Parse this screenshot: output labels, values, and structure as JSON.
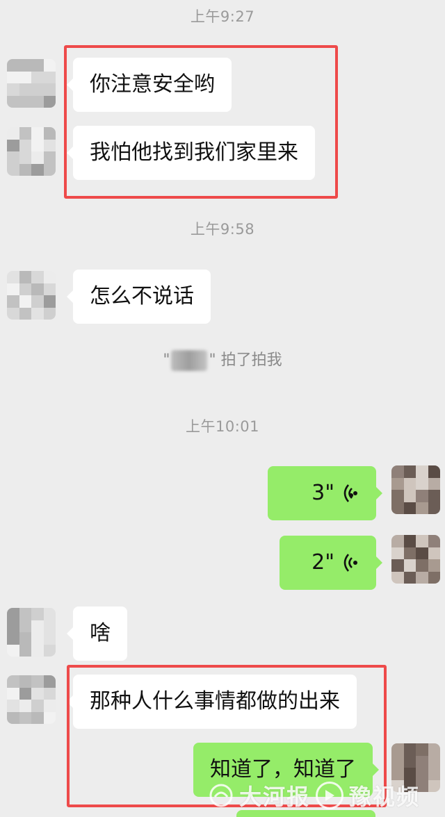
{
  "timestamps": [
    "上午9:27",
    "上午9:58",
    "上午10:01"
  ],
  "messages": [
    {
      "text": "你注意安全哟"
    },
    {
      "text": "我怕他找到我们家里来"
    },
    {
      "text": "怎么不说话"
    },
    {
      "text": "3\""
    },
    {
      "text": "2\""
    },
    {
      "text": "啥"
    },
    {
      "text": "那种人什么事情都做的出来"
    },
    {
      "text": "知道了，知道了"
    }
  ],
  "system_message": {
    "open_quote": "\"",
    "close_quote": "\"",
    "action": "拍了拍我"
  },
  "watermark": {
    "brand1": "大河报",
    "brand2": "豫视频"
  },
  "colors": {
    "incoming_bubble": "#ffffff",
    "outgoing_bubble": "#95ec69",
    "highlight_box": "#ee4a4a",
    "background": "#ededed"
  }
}
